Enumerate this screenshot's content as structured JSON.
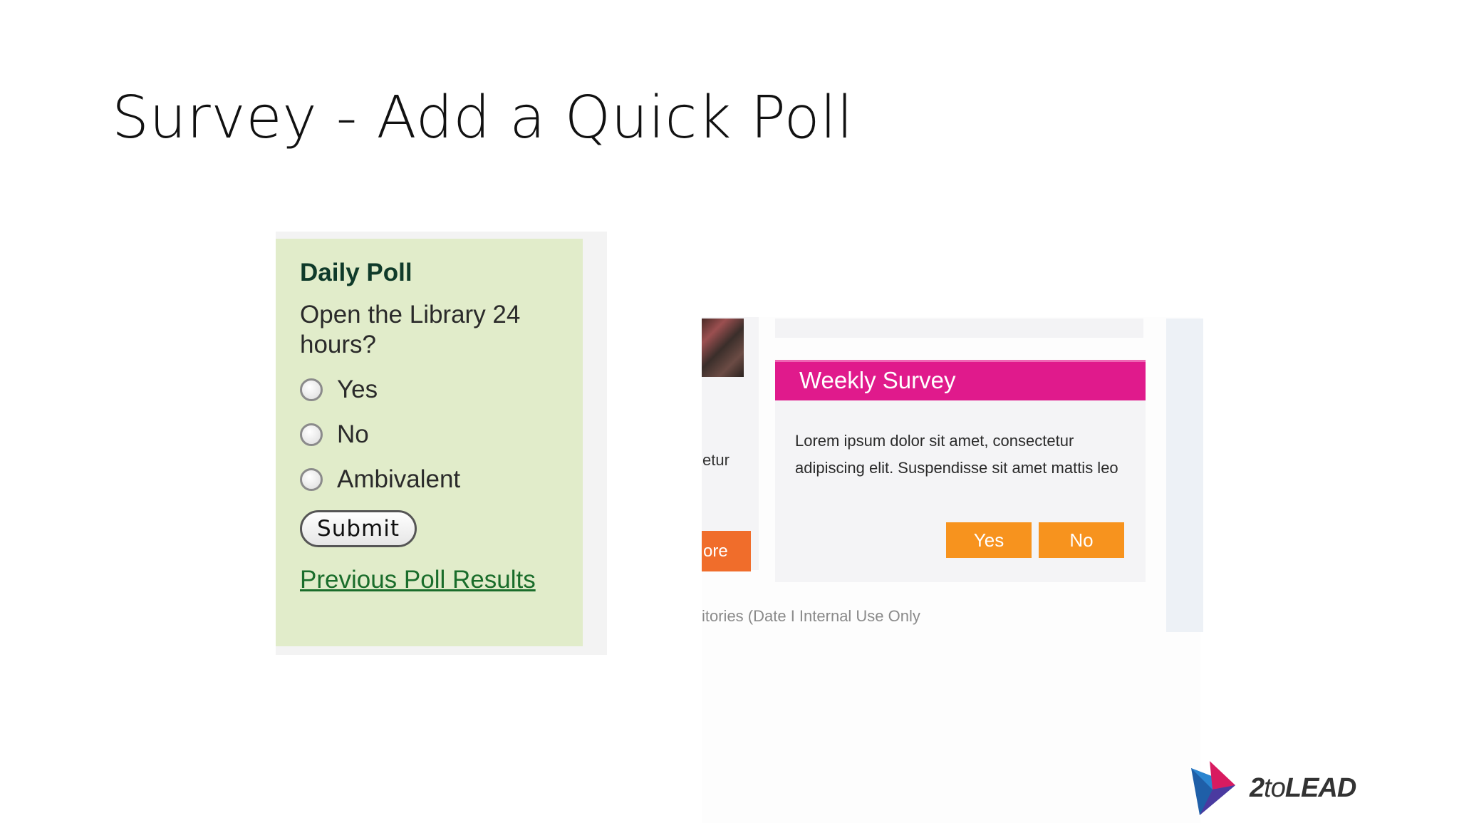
{
  "slide": {
    "title": "Survey - Add a Quick Poll"
  },
  "daily_poll": {
    "title": "Daily Poll",
    "question": "Open the Library 24 hours?",
    "options": [
      "Yes",
      "No",
      "Ambivalent"
    ],
    "submit_label": "Submit",
    "results_link": "Previous Poll Results"
  },
  "weekly_survey": {
    "left_snippet": "etur",
    "left_button": "ore",
    "header": "Weekly Survey",
    "body": "Lorem ipsum dolor sit amet, consectetur adipiscing elit. Suspendisse sit amet mattis leo",
    "yes_label": "Yes",
    "no_label": "No",
    "footer": "itories (Date  I  Internal Use Only"
  },
  "logo": {
    "part1": "2",
    "part2": "to",
    "part3": "LEAD"
  },
  "colors": {
    "poll_bg": "#e1ecca",
    "survey_header": "#e01a8c",
    "survey_button": "#f7931e"
  }
}
